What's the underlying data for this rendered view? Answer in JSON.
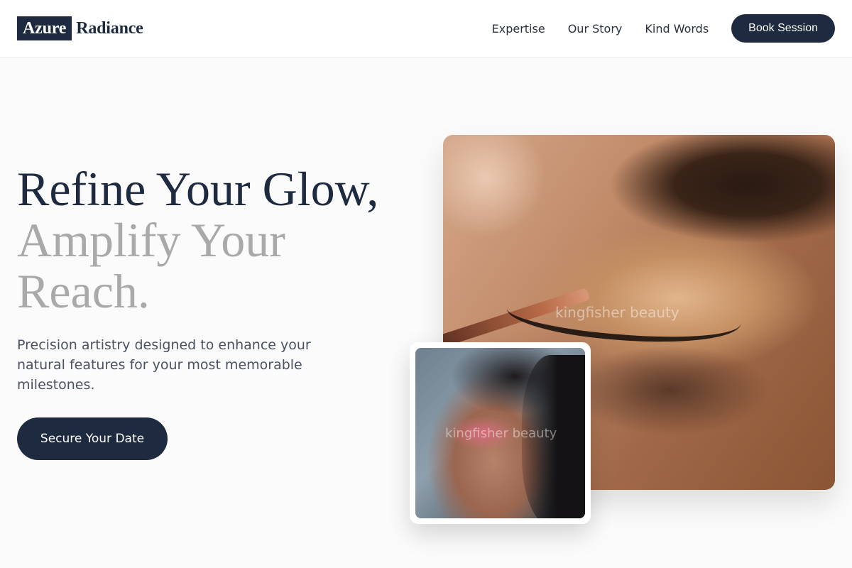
{
  "header": {
    "logo_box": "Azure",
    "logo_text": "Radiance",
    "nav": [
      "Expertise",
      "Our Story",
      "Kind Words"
    ],
    "cta": "Book Session"
  },
  "hero": {
    "headline_dark": "Refine Your Glow,",
    "headline_light": "Amplify Your Reach.",
    "subtext": "Precision artistry designed to enhance your natural features for your most memorable milestones.",
    "cta": "Secure Your Date"
  },
  "images": {
    "main_watermark": "kingfisher beauty",
    "inset_watermark": "kingfisher beauty"
  },
  "colors": {
    "navy": "#1e2a3f",
    "headline_gray": "#a9a9a9",
    "background": "#fbfbfb"
  }
}
